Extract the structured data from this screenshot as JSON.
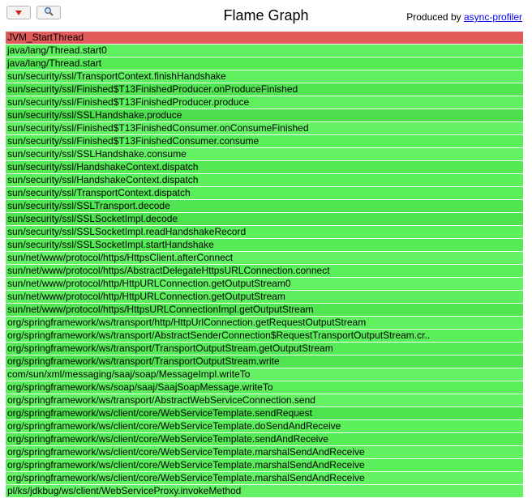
{
  "header": {
    "title": "Flame Graph",
    "produced_by": "Produced by",
    "link_text": "async-profiler"
  },
  "icons": {
    "reverse": "triangle-down-icon",
    "search": "magnifier-icon"
  },
  "colors": {
    "reverse_icon": "#cc2222",
    "root_frame": "#e15a5a",
    "green_a": "#50e150",
    "green_b": "#64f064"
  },
  "frames": [
    {
      "label": "JVM_StartThread",
      "color": "#e15a5a"
    },
    {
      "label": "java/lang/Thread.start0",
      "color": "#5ef05e"
    },
    {
      "label": "java/lang/Thread.start",
      "color": "#54ea54"
    },
    {
      "label": "sun/security/ssl/TransportContext.finishHandshake",
      "color": "#5ef05e"
    },
    {
      "label": "sun/security/ssl/Finished$T13FinishedProducer.onProduceFinished",
      "color": "#50e450"
    },
    {
      "label": "sun/security/ssl/Finished$T13FinishedProducer.produce",
      "color": "#5ef05e"
    },
    {
      "label": "sun/security/ssl/SSLHandshake.produce",
      "color": "#4cde4c"
    },
    {
      "label": "sun/security/ssl/Finished$T13FinishedConsumer.onConsumeFinished",
      "color": "#64f264"
    },
    {
      "label": "sun/security/ssl/Finished$T13FinishedConsumer.consume",
      "color": "#5aee5a"
    },
    {
      "label": "sun/security/ssl/SSLHandshake.consume",
      "color": "#64f264"
    },
    {
      "label": "sun/security/ssl/HandshakeContext.dispatch",
      "color": "#54e854"
    },
    {
      "label": "sun/security/ssl/HandshakeContext.dispatch",
      "color": "#5cf05c"
    },
    {
      "label": "sun/security/ssl/TransportContext.dispatch",
      "color": "#5aee5a"
    },
    {
      "label": "sun/security/ssl/SSLTransport.decode",
      "color": "#50e450"
    },
    {
      "label": "sun/security/ssl/SSLSocketImpl.decode",
      "color": "#4ee24e"
    },
    {
      "label": "sun/security/ssl/SSLSocketImpl.readHandshakeRecord",
      "color": "#5cf05c"
    },
    {
      "label": "sun/security/ssl/SSLSocketImpl.startHandshake",
      "color": "#56ea56"
    },
    {
      "label": "sun/net/www/protocol/https/HttpsClient.afterConnect",
      "color": "#64f264"
    },
    {
      "label": "sun/net/www/protocol/https/AbstractDelegateHttpsURLConnection.connect",
      "color": "#5aee5a"
    },
    {
      "label": "sun/net/www/protocol/http/HttpURLConnection.getOutputStream0",
      "color": "#62f262"
    },
    {
      "label": "sun/net/www/protocol/http/HttpURLConnection.getOutputStream",
      "color": "#5cee5c"
    },
    {
      "label": "sun/net/www/protocol/https/HttpsURLConnectionImpl.getOutputStream",
      "color": "#52e652"
    },
    {
      "label": "org/springframework/ws/transport/http/HttpUrlConnection.getRequestOutputStream",
      "color": "#60f060"
    },
    {
      "label": "org/springframework/ws/transport/AbstractSenderConnection$RequestTransportOutputStream.cr..",
      "color": "#5aee5a"
    },
    {
      "label": "org/springframework/ws/transport/TransportOutputStream.getOutputStream",
      "color": "#56ea56"
    },
    {
      "label": "org/springframework/ws/transport/TransportOutputStream.write",
      "color": "#50e450"
    },
    {
      "label": "com/sun/xml/messaging/saaj/soap/MessageImpl.writeTo",
      "color": "#64f264"
    },
    {
      "label": "org/springframework/ws/soap/saaj/SaajSoapMessage.writeTo",
      "color": "#5aee5a"
    },
    {
      "label": "org/springframework/ws/transport/AbstractWebServiceConnection.send",
      "color": "#62f262"
    },
    {
      "label": "org/springframework/ws/client/core/WebServiceTemplate.sendRequest",
      "color": "#4ee24e"
    },
    {
      "label": "org/springframework/ws/client/core/WebServiceTemplate.doSendAndReceive",
      "color": "#5cf05c"
    },
    {
      "label": "org/springframework/ws/client/core/WebServiceTemplate.sendAndReceive",
      "color": "#56ea56"
    },
    {
      "label": "org/springframework/ws/client/core/WebServiceTemplate.marshalSendAndReceive",
      "color": "#60f060"
    },
    {
      "label": "org/springframework/ws/client/core/WebServiceTemplate.marshalSendAndReceive",
      "color": "#5aee5a"
    },
    {
      "label": "org/springframework/ws/client/core/WebServiceTemplate.marshalSendAndReceive",
      "color": "#62f262"
    },
    {
      "label": "pl/ks/jdkbug/ws/client/WebServiceProxy.invokeMethod",
      "color": "#64f264"
    }
  ]
}
